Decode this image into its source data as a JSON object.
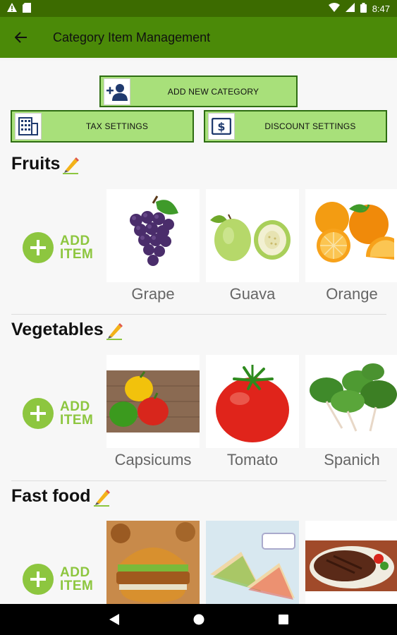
{
  "status_bar": {
    "time": "8:47"
  },
  "app_bar": {
    "title": "Category Item Management"
  },
  "buttons": {
    "add_category": "ADD NEW CATEGORY",
    "tax_settings": "TAX SETTINGS",
    "discount_settings": "DISCOUNT SETTINGS"
  },
  "add_item": {
    "line1": "ADD",
    "line2": "ITEM"
  },
  "categories": [
    {
      "name": "Fruits",
      "items": [
        "Grape",
        "Guava",
        "Orange"
      ]
    },
    {
      "name": "Vegetables",
      "items": [
        "Capsicums",
        "Tomato",
        "Spanich"
      ]
    },
    {
      "name": "Fast food",
      "items": [
        "",
        "",
        ""
      ]
    }
  ],
  "colors": {
    "app_bar": "#4b8a08",
    "status_bar": "#3c6b00",
    "button_fill": "#a8e07a",
    "accent": "#8dc63f"
  }
}
